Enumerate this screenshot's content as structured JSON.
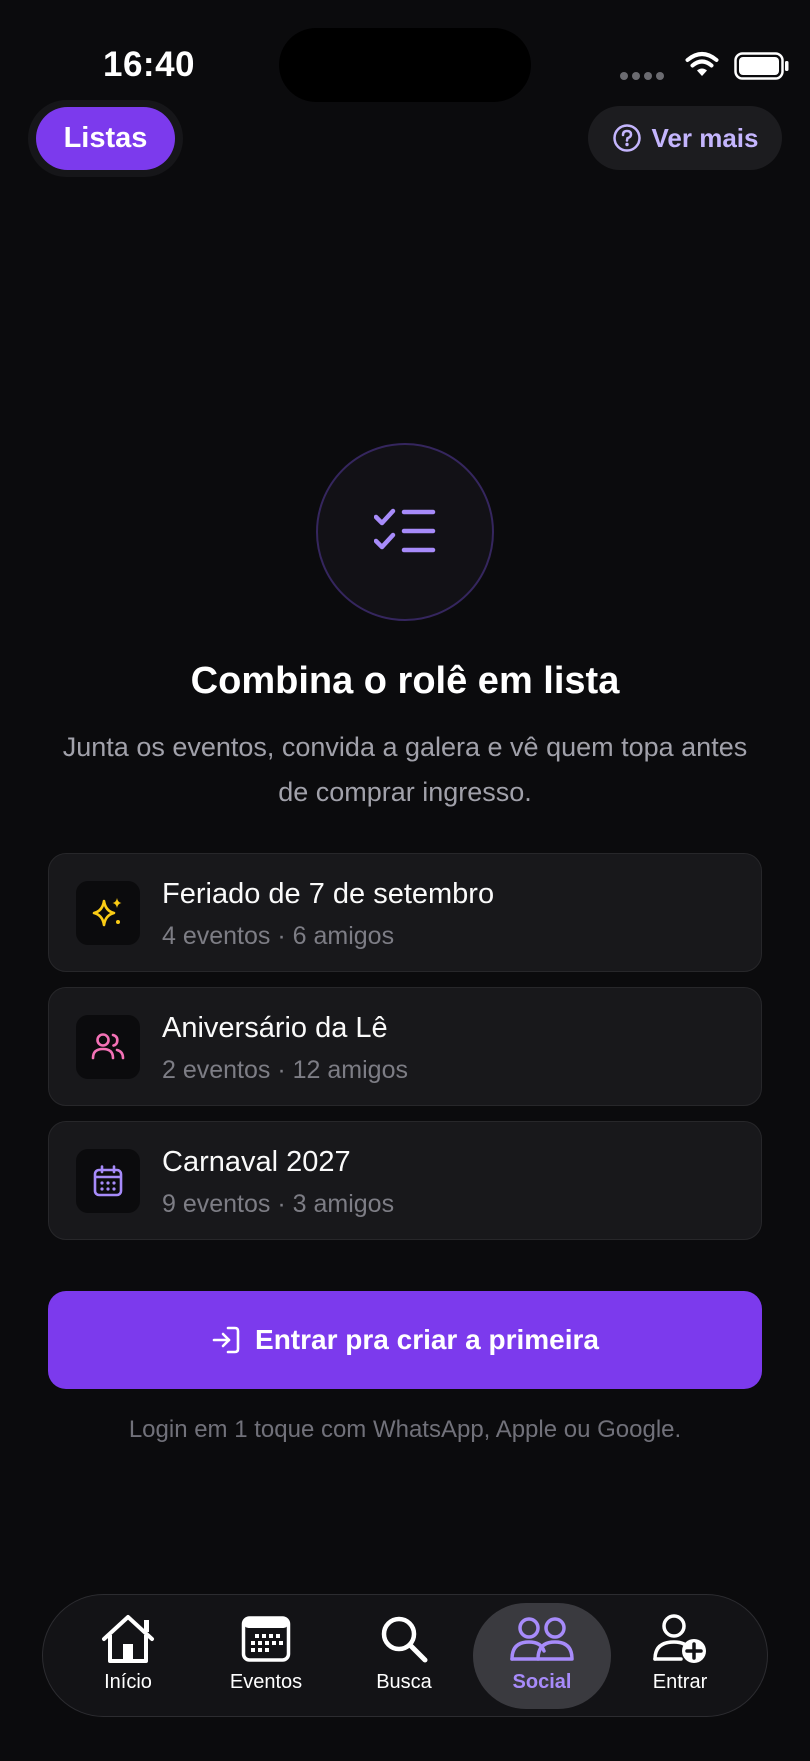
{
  "status_bar": {
    "time": "16:40"
  },
  "header": {
    "tab_label": "Listas",
    "help_label": "Ver mais"
  },
  "hero": {
    "icon": "checklist-icon",
    "title": "Combina o rolê em lista",
    "subtitle": "Junta os eventos, convida a galera e vê quem topa antes de comprar ingresso."
  },
  "lists": [
    {
      "icon": "sparkles-icon",
      "icon_color": "#facc15",
      "title": "Feriado de 7 de setembro",
      "meta": "4 eventos · 6 amigos"
    },
    {
      "icon": "users-icon",
      "icon_color": "#f472b6",
      "title": "Aniversário da Lê",
      "meta": "2 eventos · 12 amigos"
    },
    {
      "icon": "calendar-icon",
      "icon_color": "#a78bfa",
      "title": "Carnaval 2027",
      "meta": "9 eventos · 3 amigos"
    }
  ],
  "cta": {
    "label": "Entrar pra criar a primeira",
    "note": "Login em 1 toque com WhatsApp, Apple ou Google."
  },
  "tabbar": {
    "items": [
      {
        "label": "Início",
        "icon": "home-icon"
      },
      {
        "label": "Eventos",
        "icon": "calendar-grid-icon"
      },
      {
        "label": "Busca",
        "icon": "search-icon"
      },
      {
        "label": "Social",
        "icon": "social-icon",
        "active": true
      },
      {
        "label": "Entrar",
        "icon": "user-plus-icon"
      }
    ]
  },
  "colors": {
    "accent": "#7c3aed",
    "accent_light": "#a78bfa",
    "background": "#0b0b0d",
    "card": "#18181b"
  }
}
